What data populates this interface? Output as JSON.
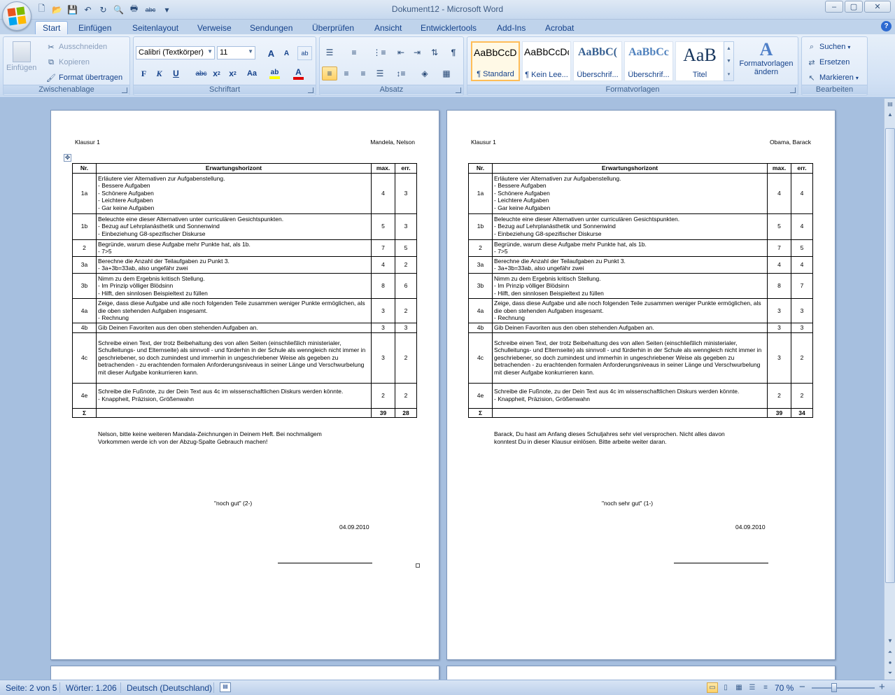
{
  "window": {
    "title": "Dokument12 - Microsoft Word",
    "controls": {
      "minimize": "–",
      "maximize": "▢",
      "close": "✕"
    }
  },
  "quick_access": [
    {
      "name": "new-doc-icon",
      "glyph": "🗋"
    },
    {
      "name": "open-icon",
      "glyph": "📂"
    },
    {
      "name": "save-icon",
      "glyph": "💾"
    },
    {
      "name": "undo-icon",
      "glyph": "↶"
    },
    {
      "name": "redo-icon",
      "glyph": "↻"
    },
    {
      "name": "print-preview-icon",
      "glyph": "🔍"
    },
    {
      "name": "print-icon",
      "glyph": "🖶"
    },
    {
      "name": "spelling-icon",
      "glyph": "abc"
    },
    {
      "name": "customize-qat-icon",
      "glyph": "▾"
    }
  ],
  "tabs": [
    "Start",
    "Einfügen",
    "Seitenlayout",
    "Verweise",
    "Sendungen",
    "Überprüfen",
    "Ansicht",
    "Entwicklertools",
    "Add-Ins",
    "Acrobat"
  ],
  "ribbon": {
    "clipboard": {
      "label": "Zwischenablage",
      "paste": "Einfügen",
      "cut": "Ausschneiden",
      "copy": "Kopieren",
      "format_painter": "Format übertragen"
    },
    "font": {
      "label": "Schriftart",
      "font_name": "Calibri (Textkörper)",
      "font_size": "11",
      "grow": "A",
      "shrink": "A",
      "bold": "F",
      "italic": "K",
      "underline": "U",
      "strikethrough": "abc",
      "subscript": "x",
      "superscript": "x",
      "change_case": "Aa",
      "highlight": "ab",
      "font_color": "A",
      "highlight_color": "#ffff00",
      "font_color_value": "#e00000"
    },
    "paragraph": {
      "label": "Absatz"
    },
    "styles": {
      "label": "Formatvorlagen",
      "items": [
        {
          "preview": "AaBbCcDc",
          "name": "¶ Standard"
        },
        {
          "preview": "AaBbCcDc",
          "name": "¶ Kein Lee..."
        },
        {
          "preview": "AaBbC(",
          "name": "Überschrif..."
        },
        {
          "preview": "AaBbCc",
          "name": "Überschrif..."
        },
        {
          "preview": "AaB",
          "name": "Titel"
        }
      ],
      "change_styles": "Formatvorlagen ändern"
    },
    "editing": {
      "label": "Bearbeiten",
      "find": "Suchen",
      "replace": "Ersetzen",
      "select": "Markieren"
    }
  },
  "pages": [
    {
      "header_left": "Klausur 1",
      "header_right": "Mandela, Nelson",
      "table": {
        "headers": [
          "Nr.",
          "Erwartungshorizont",
          "max.",
          "err."
        ],
        "rows": [
          {
            "nr": "1a",
            "text": "Erläutere vier Alternativen zur Aufgabenstellung.\n- Bessere Aufgaben\n- Schönere Aufgaben\n- Leichtere Aufgaben\n- Gar keine Aufgaben",
            "max": "4",
            "err": "3"
          },
          {
            "nr": "1b",
            "text": "Beleuchte eine dieser Alternativen unter curriculären Gesichtspunkten.\n- Bezug auf Lehrplanästhetik und Sonnenwind\n- Einbeziehung G8-spezifischer Diskurse",
            "max": "5",
            "err": "3"
          },
          {
            "nr": "2",
            "text": "Begründe, warum diese Aufgabe mehr Punkte hat, als 1b.\n- 7>5",
            "max": "7",
            "err": "5"
          },
          {
            "nr": "3a",
            "text": "Berechne die Anzahl der Teilaufgaben zu Punkt 3.\n- 3a+3b=33ab, also ungefähr zwei",
            "max": "4",
            "err": "2"
          },
          {
            "nr": "3b",
            "text": "Nimm zu dem Ergebnis kritisch Stellung.\n- Im Prinzip völliger Blödsinn\n- Hilft, den sinnlosen Beispieltext zu füllen",
            "max": "8",
            "err": "6"
          },
          {
            "nr": "4a",
            "text": "Zeige, dass diese Aufgabe und alle noch folgenden Teile zusammen weniger Punkte ermöglichen, als die oben stehenden Aufgaben insgesamt.\n- Rechnung",
            "max": "3",
            "err": "2"
          },
          {
            "nr": "4b",
            "text": "Gib Deinen Favoriten aus den oben stehenden Aufgaben an.",
            "max": "3",
            "err": "3"
          },
          {
            "nr": "4c",
            "text": "Schreibe einen Text, der trotz Beibehaltung des von allen Seiten (einschließlich ministerialer, Schulleitungs- und Elternseite) als sinnvoll - und fürderhin in der Schule als wenngleich nicht immer in geschriebener, so doch zumindest und immerhin in ungeschriebener Weise als gegeben zu betrachenden - zu erachtenden formalen Anforderungsniveaus in seiner Länge und Verschwurbelung mit dieser Aufgabe konkurrieren kann.",
            "max": "3",
            "err": "2"
          },
          {
            "nr": "4e",
            "text": "Schreibe die Fußnote, zu der Dein Text aus 4c im wissenschaftlichen Diskurs werden könnte.\n- Knappheit, Präzision, Größenwahn",
            "max": "2",
            "err": "2"
          },
          {
            "nr": "Σ",
            "text": "",
            "max": "39",
            "err": "28"
          }
        ]
      },
      "comment": "Nelson, bitte keine weiteren Mandala-Zeichnungen in Deinem Heft. Bei nochmaligem\nVorkommen werde ich von der Abzug-Spalte Gebrauch machen!",
      "grade": "\"noch gut\" (2-)",
      "date": "04.09.2010"
    },
    {
      "header_left": "Klausur 1",
      "header_right": "Obama, Barack",
      "table": {
        "headers": [
          "Nr.",
          "Erwartungshorizont",
          "max.",
          "err."
        ],
        "rows": [
          {
            "nr": "1a",
            "text": "Erläutere vier Alternativen zur Aufgabenstellung.\n- Bessere Aufgaben\n- Schönere Aufgaben\n- Leichtere Aufgaben\n- Gar keine Aufgaben",
            "max": "4",
            "err": "4"
          },
          {
            "nr": "1b",
            "text": "Beleuchte eine dieser Alternativen unter curriculären Gesichtspunkten.\n- Bezug auf Lehrplanästhetik und Sonnenwind\n- Einbeziehung G8-spezifischer Diskurse",
            "max": "5",
            "err": "4"
          },
          {
            "nr": "2",
            "text": "Begründe, warum diese Aufgabe mehr Punkte hat, als 1b.\n- 7>5",
            "max": "7",
            "err": "5"
          },
          {
            "nr": "3a",
            "text": "Berechne die Anzahl der Teilaufgaben zu Punkt 3.\n- 3a+3b=33ab, also ungefähr zwei",
            "max": "4",
            "err": "4"
          },
          {
            "nr": "3b",
            "text": "Nimm zu dem Ergebnis kritisch Stellung.\n- Im Prinzip völliger Blödsinn\n- Hilft, den sinnlosen Beispieltext zu füllen",
            "max": "8",
            "err": "7"
          },
          {
            "nr": "4a",
            "text": "Zeige, dass diese Aufgabe und alle noch folgenden Teile zusammen weniger Punkte ermöglichen, als die oben stehenden Aufgaben insgesamt.\n- Rechnung",
            "max": "3",
            "err": "3"
          },
          {
            "nr": "4b",
            "text": "Gib Deinen Favoriten aus den oben stehenden Aufgaben an.",
            "max": "3",
            "err": "3"
          },
          {
            "nr": "4c",
            "text": "Schreibe einen Text, der trotz Beibehaltung des von allen Seiten (einschließlich ministerialer, Schulleitungs- und Elternseite) als sinnvoll - und fürderhin in der Schule als wenngleich nicht immer in geschriebener, so doch zumindest und immerhin in ungeschriebener Weise als gegeben zu betrachenden - zu erachtenden formalen Anforderungsniveaus in seiner Länge und Verschwurbelung mit dieser Aufgabe konkurrieren kann.",
            "max": "3",
            "err": "2"
          },
          {
            "nr": "4e",
            "text": "Schreibe die Fußnote, zu der Dein Text aus 4c im wissenschaftlichen Diskurs werden könnte.\n- Knappheit, Präzision, Größenwahn",
            "max": "2",
            "err": "2"
          },
          {
            "nr": "Σ",
            "text": "",
            "max": "39",
            "err": "34"
          }
        ]
      },
      "comment": "Barack, Du hast am Anfang dieses Schuljahres sehr viel versprochen. Nicht alles davon\nkonntest Du in dieser Klausur einlösen. Bitte arbeite weiter daran.",
      "grade": "\"noch sehr gut\" (1-)",
      "date": "04.09.2010"
    }
  ],
  "status": {
    "page": "Seite: 2 von 5",
    "words": "Wörter: 1.206",
    "language": "Deutsch (Deutschland)",
    "zoom": "70 %",
    "zoom_out": "−",
    "zoom_in": "+",
    "zoom_fraction": 0.35
  }
}
